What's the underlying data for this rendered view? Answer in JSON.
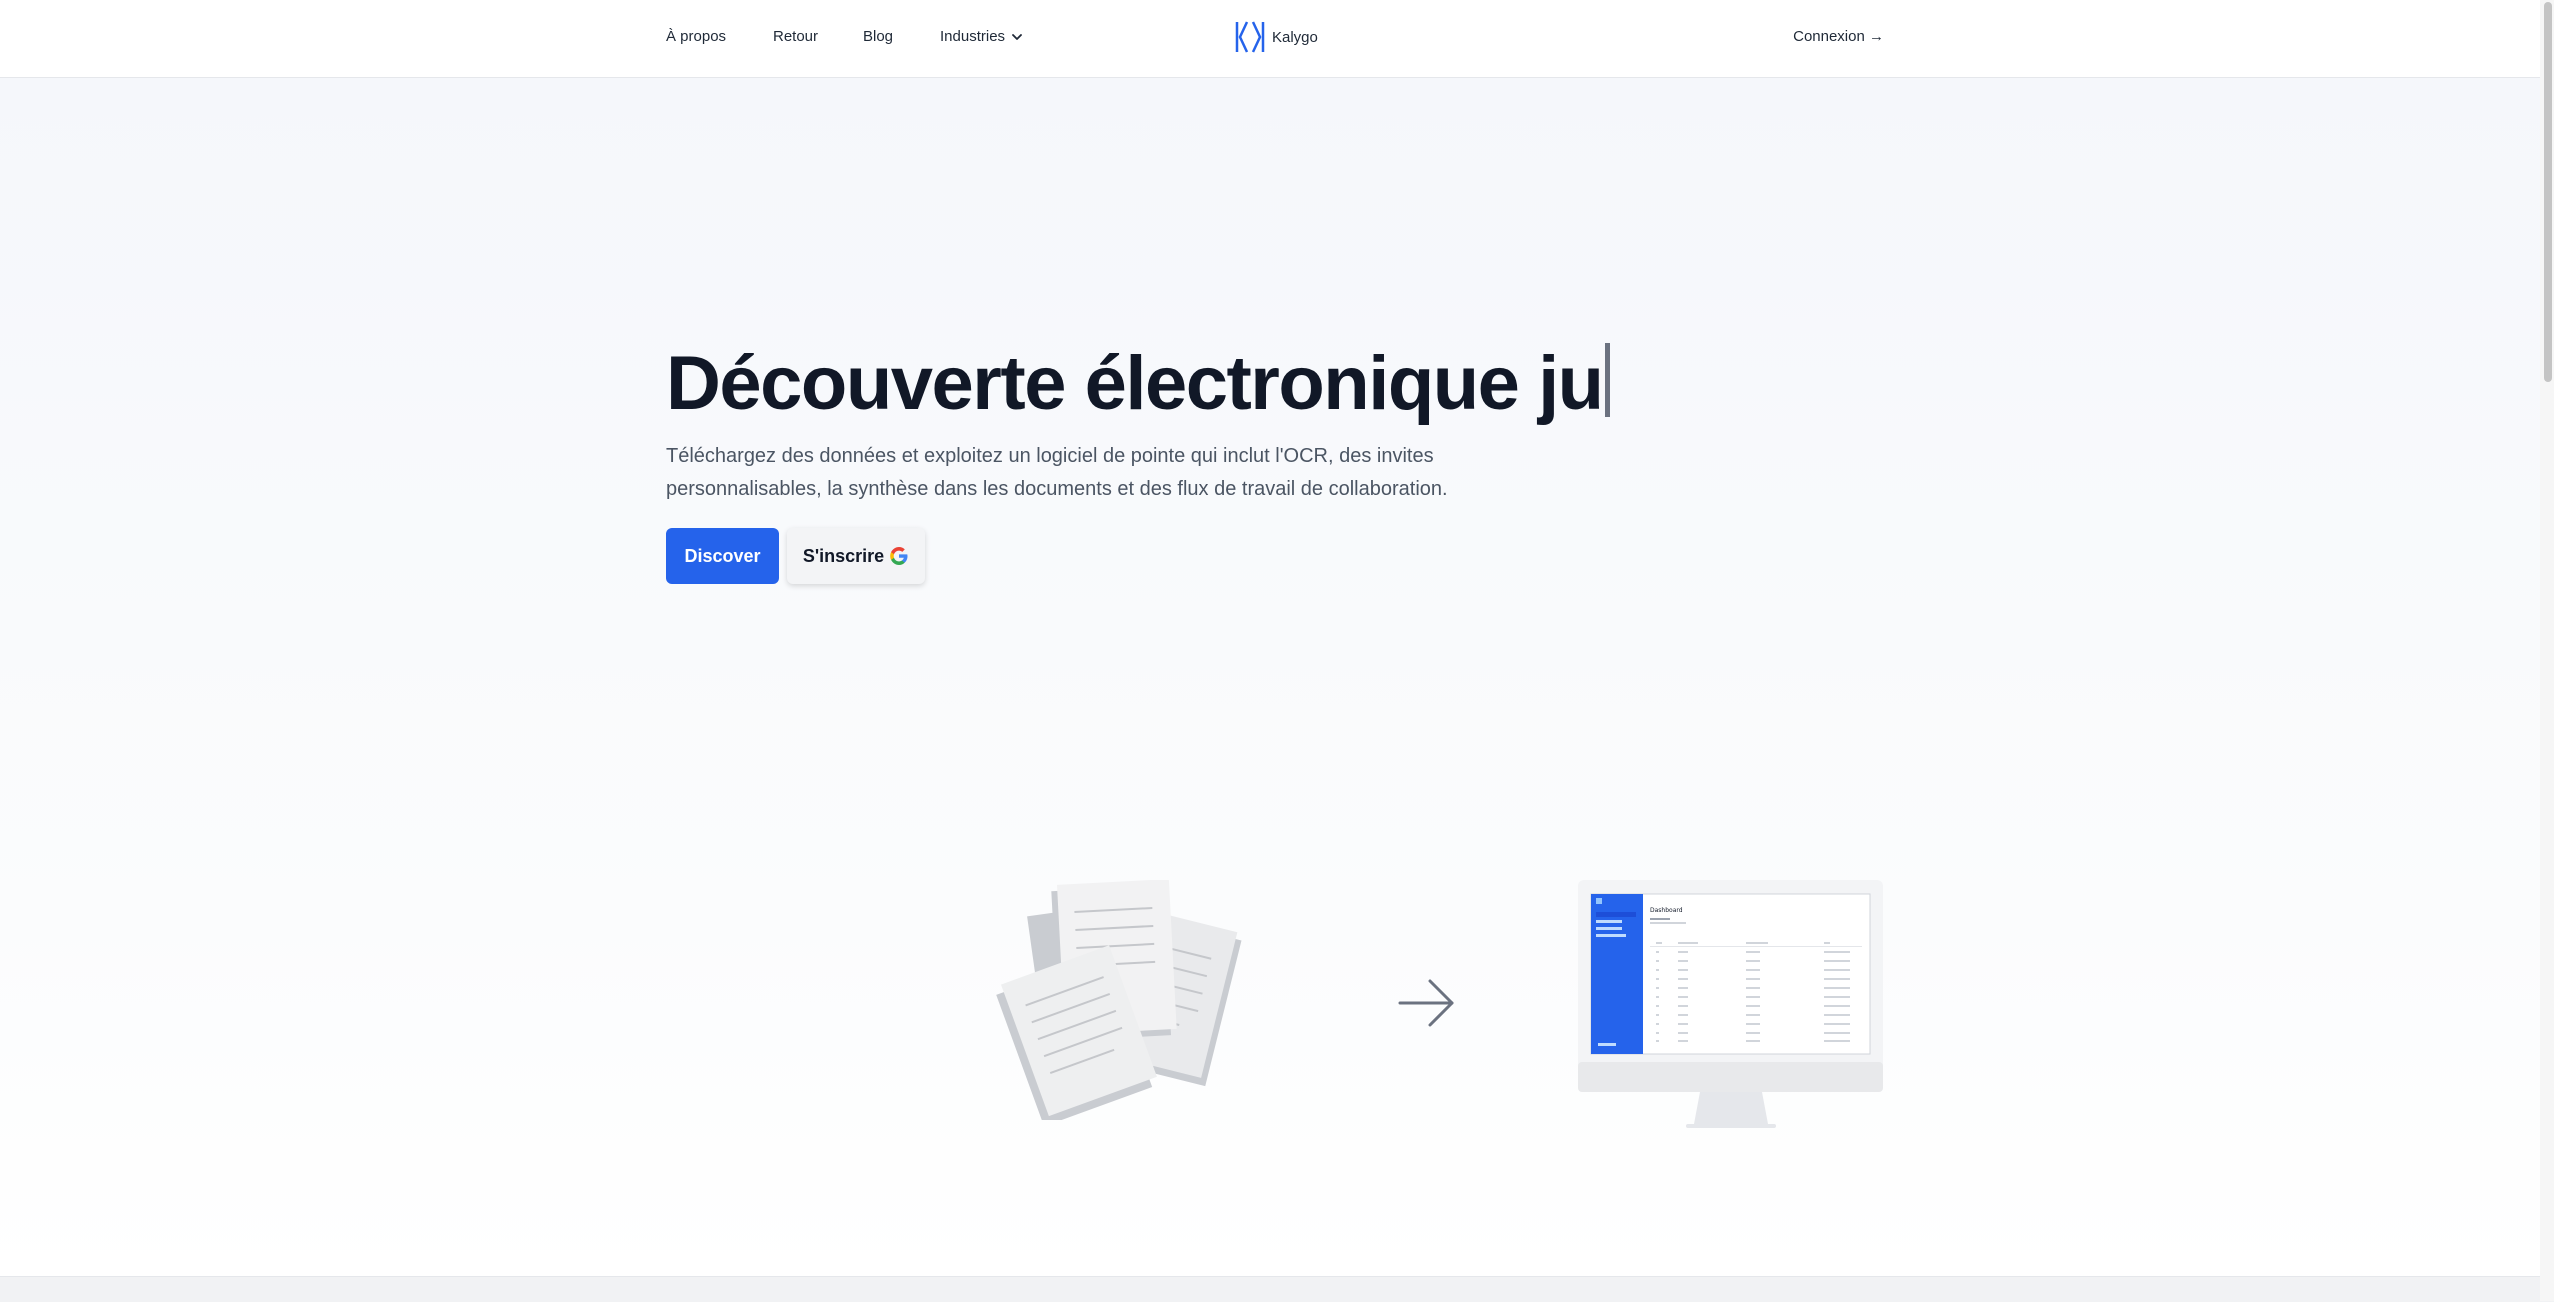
{
  "nav": {
    "about": "À propos",
    "feedback": "Retour",
    "blog": "Blog",
    "industries": "Industries",
    "brand": "Kalygo",
    "login": "Connexion →"
  },
  "hero": {
    "title": "Découverte électronique ju",
    "subtitle": "Téléchargez des données et exploitez un logiciel de pointe qui inclut l'OCR, des invites personnalisables, la synthèse dans les documents et des flux de travail de collaboration.",
    "discover_label": "Discover",
    "signup_label": "S'inscrire"
  },
  "illustration": {
    "dashboard_title": "Dashboard"
  },
  "icons": {
    "industries": "chevron-down-icon",
    "logo": "kalygo-logo-icon",
    "google": "google-icon",
    "arrow": "arrow-right-icon"
  },
  "colors": {
    "primary": "#2563eb",
    "text": "#111827",
    "muted": "#4b5563"
  }
}
